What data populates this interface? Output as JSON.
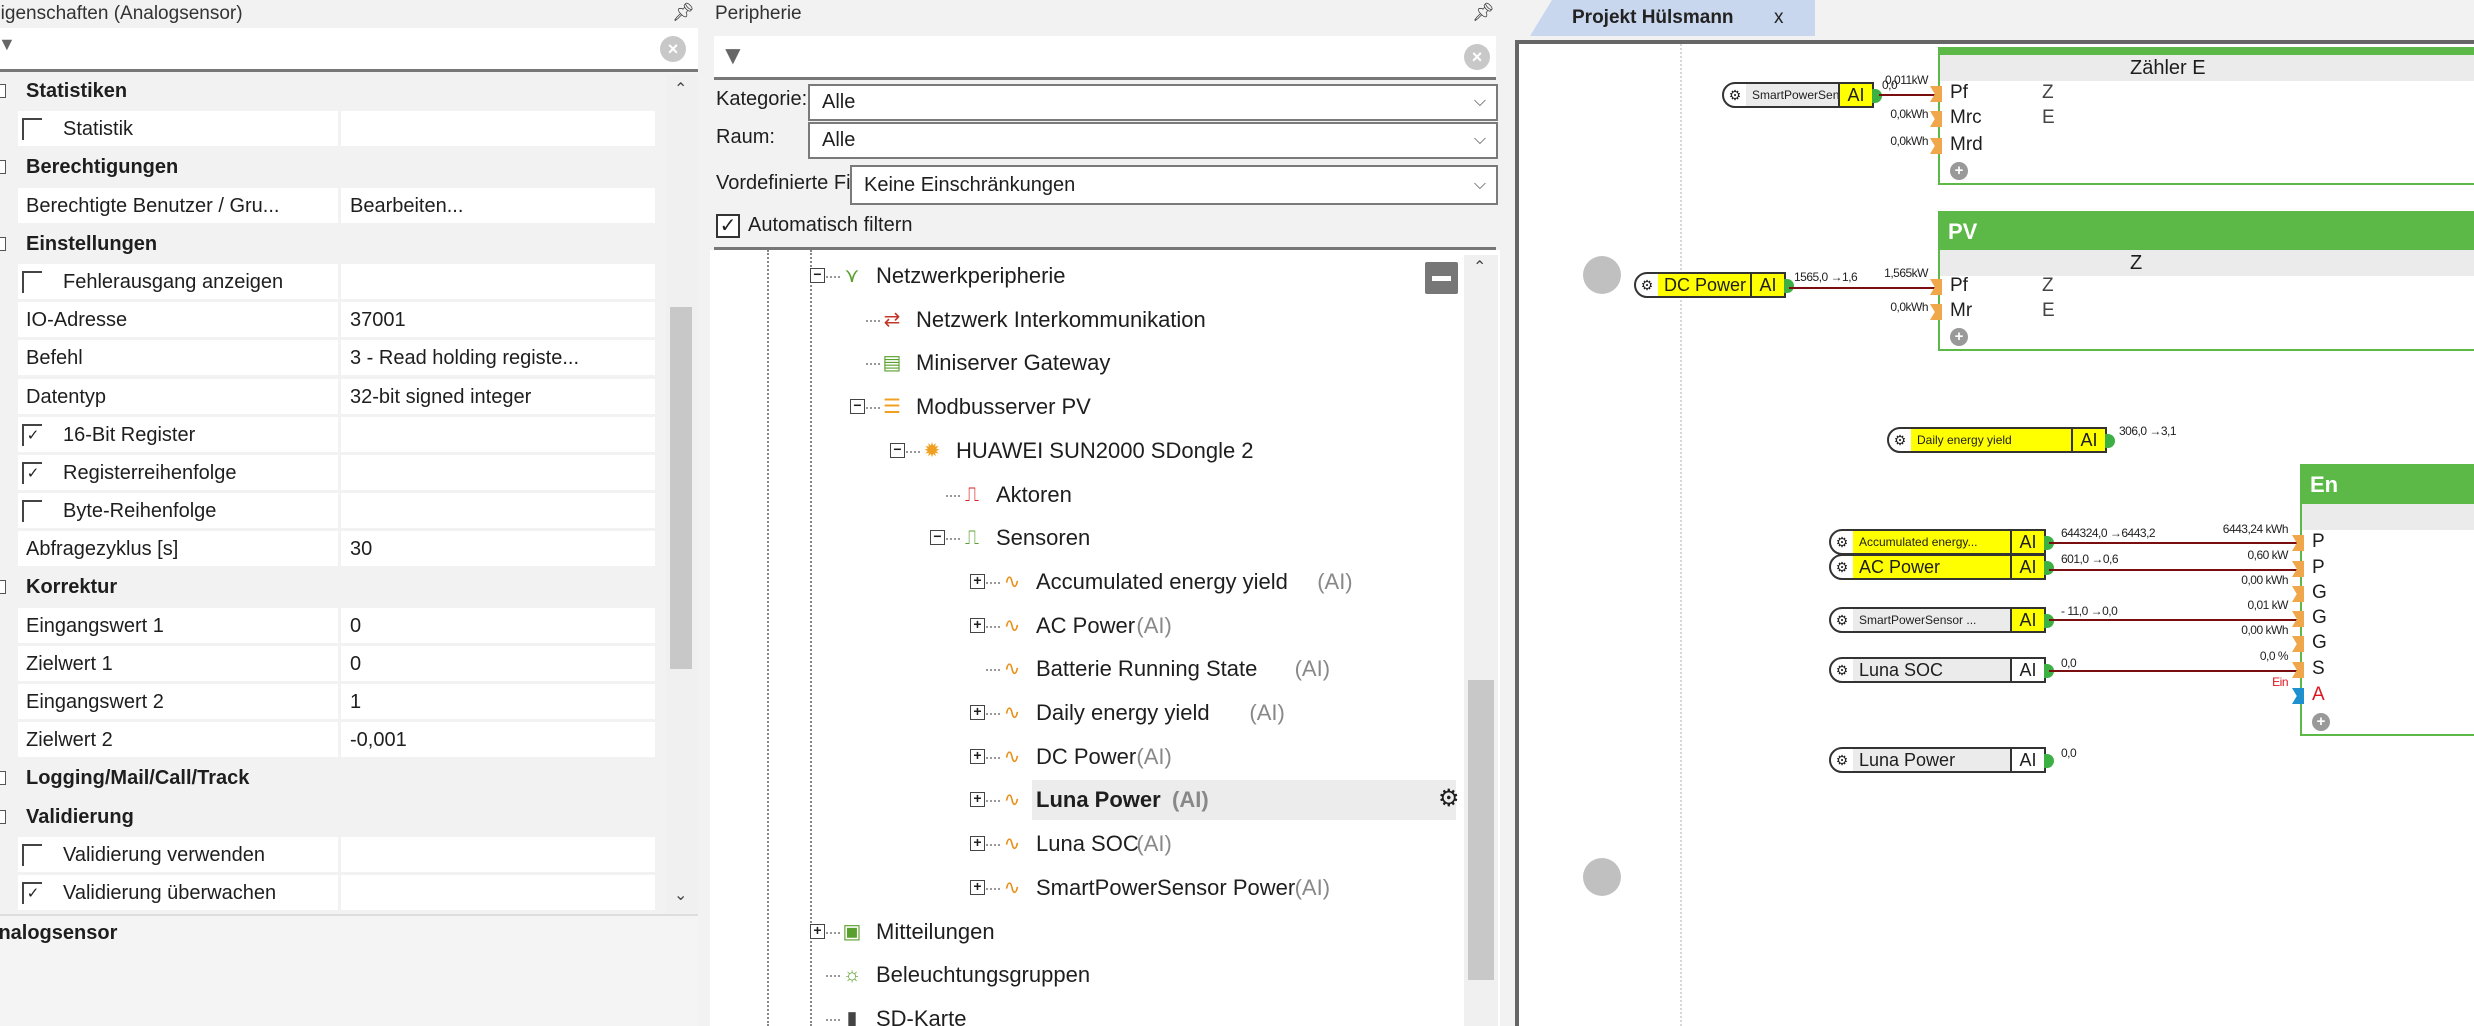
{
  "properties": {
    "title": "Eigenschaften (Analogsensor)",
    "rows": [
      {
        "type": "cat",
        "label": "Statistiken"
      },
      {
        "type": "check",
        "label": "Statistik",
        "checked": false
      },
      {
        "type": "cat",
        "label": "Berechtigungen"
      },
      {
        "type": "kv",
        "label": "Berechtigte Benutzer / Gru...",
        "value": "Bearbeiten..."
      },
      {
        "type": "cat",
        "label": "Einstellungen"
      },
      {
        "type": "check",
        "label": "Fehlerausgang anzeigen",
        "checked": false
      },
      {
        "type": "kv",
        "label": "IO-Adresse",
        "value": "37001"
      },
      {
        "type": "kv",
        "label": "Befehl",
        "value": "3 - Read holding registe..."
      },
      {
        "type": "kv",
        "label": "Datentyp",
        "value": "32-bit signed integer"
      },
      {
        "type": "check",
        "label": "16-Bit Register",
        "checked": true
      },
      {
        "type": "check",
        "label": "Registerreihenfolge",
        "checked": true
      },
      {
        "type": "check",
        "label": "Byte-Reihenfolge",
        "checked": false
      },
      {
        "type": "kv",
        "label": "Abfragezyklus [s]",
        "value": "30"
      },
      {
        "type": "cat",
        "label": "Korrektur"
      },
      {
        "type": "kv",
        "label": "Eingangswert 1",
        "value": "0"
      },
      {
        "type": "kv",
        "label": "Zielwert 1",
        "value": "0"
      },
      {
        "type": "kv",
        "label": "Eingangswert 2",
        "value": "1"
      },
      {
        "type": "kv",
        "label": "Zielwert 2",
        "value": "-0,001"
      },
      {
        "type": "cat",
        "label": "Logging/Mail/Call/Track"
      },
      {
        "type": "cat",
        "label": "Validierung"
      },
      {
        "type": "check",
        "label": "Validierung verwenden",
        "checked": false
      },
      {
        "type": "check",
        "label": "Validierung überwachen",
        "checked": true
      }
    ],
    "description_title": "Analogsensor"
  },
  "peripherie": {
    "title": "Peripherie",
    "kategorie_label": "Kategorie:",
    "kategorie_value": "Alle",
    "raum_label": "Raum:",
    "raum_value": "Alle",
    "filter_label": "Vordefinierte Filter",
    "filter_value": "Keine Einschränkungen",
    "auto_filter_label": "Automatisch filtern",
    "auto_filter_checked": true,
    "tree": [
      {
        "label": "Netzwerkperipherie",
        "level": 0,
        "exp": "minus",
        "icon": "network-icon"
      },
      {
        "label": "Netzwerk Interkommunikation",
        "level": 1,
        "exp": "none",
        "icon": "intercom-icon"
      },
      {
        "label": "Miniserver Gateway",
        "level": 1,
        "exp": "none",
        "icon": "gateway-icon"
      },
      {
        "label": "Modbusserver PV",
        "level": 1,
        "exp": "minus",
        "icon": "database-icon"
      },
      {
        "label": "HUAWEI SUN2000 SDongle 2",
        "level": 2,
        "exp": "minus",
        "icon": "device-icon"
      },
      {
        "label": "Aktoren",
        "level": 3,
        "exp": "none",
        "icon": "actuators-icon"
      },
      {
        "label": "Sensoren",
        "level": 3,
        "exp": "minus",
        "icon": "sensors-icon"
      },
      {
        "label": "Accumulated energy yield",
        "suffix": "(AI)",
        "level": 4,
        "exp": "plus",
        "icon": "analog-input-icon"
      },
      {
        "label": "AC Power",
        "suffix": "(AI)",
        "level": 4,
        "exp": "plus",
        "icon": "analog-input-icon"
      },
      {
        "label": "Batterie Running State",
        "suffix": "(AI)",
        "level": 4,
        "exp": "none",
        "icon": "analog-input-icon"
      },
      {
        "label": "Daily energy yield",
        "suffix": "(AI)",
        "level": 4,
        "exp": "plus",
        "icon": "analog-input-icon"
      },
      {
        "label": "DC Power",
        "suffix": "(AI)",
        "level": 4,
        "exp": "plus",
        "icon": "analog-input-icon"
      },
      {
        "label": "Luna Power",
        "suffix": "(AI)",
        "level": 4,
        "exp": "plus",
        "icon": "analog-input-icon",
        "selected": true
      },
      {
        "label": "Luna SOC",
        "suffix": "(AI)",
        "level": 4,
        "exp": "plus",
        "icon": "analog-input-icon"
      },
      {
        "label": "SmartPowerSensor Power",
        "suffix": "(AI)",
        "level": 4,
        "exp": "plus",
        "icon": "analog-input-icon"
      },
      {
        "label": "Mitteilungen",
        "level": 0,
        "exp": "plus",
        "icon": "log-icon"
      },
      {
        "label": "Beleuchtungsgruppen",
        "level": 0,
        "exp": "none",
        "icon": "lighting-group-icon"
      },
      {
        "label": "SD-Karte",
        "level": 0,
        "exp": "none",
        "icon": "sd-card-icon"
      }
    ]
  },
  "editor": {
    "tab_label": "Projekt Hülsmann",
    "tab_close": "x",
    "blocks": {
      "sps_top": {
        "name": "SmartPowerSensor ...",
        "type": "AI",
        "out": "0,0"
      },
      "dc_power": {
        "name": "DC Power",
        "type": "AI",
        "out": "1565,0 →1,6"
      },
      "daily": {
        "name": "Daily energy yield",
        "type": "AI",
        "out": "306,0 →3,1"
      },
      "accumulated": {
        "name": "Accumulated energy...",
        "type": "AI",
        "out": "644324,0 →6443,2"
      },
      "ac_power": {
        "name": "AC Power",
        "type": "AI",
        "out": "601,0 →0,6"
      },
      "sps2": {
        "name": "SmartPowerSensor ...",
        "type": "AI",
        "out": "- 11,0 →0,0"
      },
      "luna_soc": {
        "name": "Luna SOC",
        "type": "AI",
        "out": "0,0"
      },
      "luna_power": {
        "name": "Luna Power",
        "type": "AI",
        "out": "0,0"
      }
    },
    "zaehler": {
      "subtitle": "Zähler E",
      "ports": [
        "Pf",
        "Mrc",
        "Mrd"
      ],
      "right": [
        "Z",
        "E"
      ],
      "inputs": [
        "0,011kW",
        "0,0kWh",
        "0,0kWh"
      ]
    },
    "pv": {
      "title": "PV",
      "subtitle": "Z",
      "ports": [
        "Pf",
        "Mr"
      ],
      "right": [
        "Z",
        "E"
      ],
      "inputs": [
        "1,565kW",
        "0,0kWh"
      ]
    },
    "energy": {
      "title": "En",
      "ports": [
        "P",
        "P",
        "G",
        "G",
        "G",
        "S",
        "A"
      ],
      "inputs": [
        "6443,24 kWh",
        "0,60 kW",
        "0,00 kWh",
        "0,01 kW",
        "0,00 kWh",
        "0,0 %",
        "Ein"
      ]
    }
  },
  "colors": {
    "block_yellow": "#ffff00",
    "block_gray": "#ebebeb",
    "fb_green": "#5cb847",
    "wire": "#7a0d0d",
    "pin_orange": "#f0a64a",
    "error_red": "#e0141e"
  }
}
